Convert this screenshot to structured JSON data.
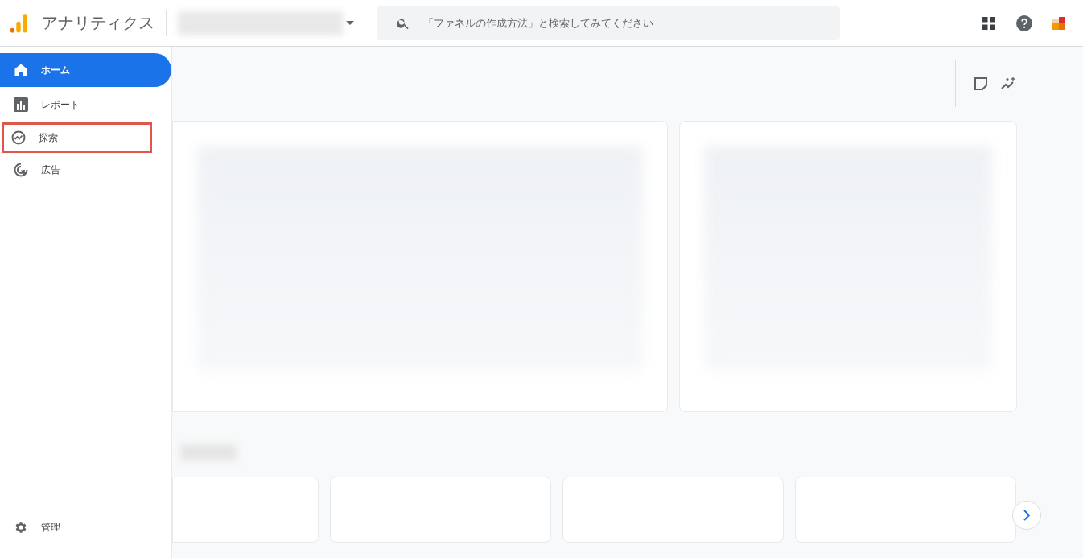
{
  "header": {
    "product_name": "アナリティクス",
    "search": {
      "placeholder": "「ファネルの作成方法」と検索してみてください"
    }
  },
  "nav": [
    {
      "label": "ホーム",
      "kind": "home",
      "selected": true,
      "highlighted": false
    },
    {
      "label": "レポート",
      "kind": "reports",
      "selected": false,
      "highlighted": false
    },
    {
      "label": "探索",
      "kind": "explore",
      "selected": false,
      "highlighted": true
    },
    {
      "label": "広告",
      "kind": "ads",
      "selected": false,
      "highlighted": false
    }
  ],
  "admin": {
    "label": "管理"
  }
}
